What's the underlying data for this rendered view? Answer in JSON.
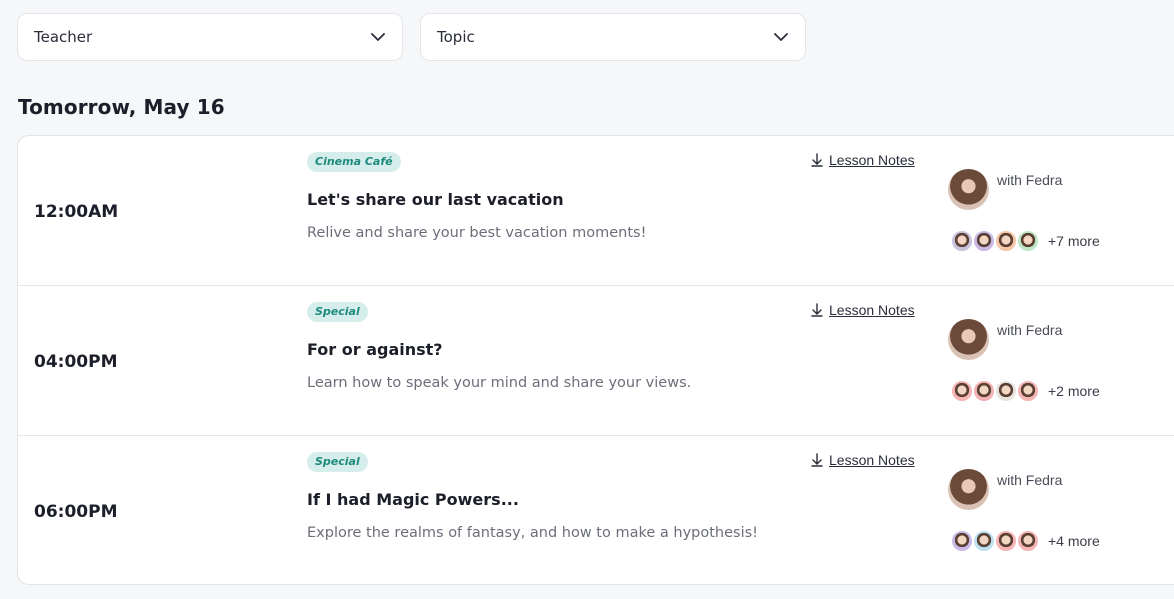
{
  "filters": {
    "teacher_label": "Teacher",
    "topic_label": "Topic"
  },
  "date_heading": "Tomorrow, May 16",
  "lesson_notes_label": "Lesson Notes",
  "lessons": [
    {
      "time": "12:00AM",
      "tag": "Cinema Café",
      "title": "Let's share our last vacation",
      "description": "Relive and share your best vacation moments!",
      "teacher": "with Fedra",
      "more": "+7 more",
      "student_colors": [
        "#c8c2dc",
        "#c9b9e6",
        "#f6c6a8",
        "#bfe6c7"
      ]
    },
    {
      "time": "04:00PM",
      "tag": "Special",
      "title": "For or against?",
      "description": "Learn how to speak your mind and share your views.",
      "teacher": "with Fedra",
      "more": "+2 more",
      "student_colors": [
        "#f5b5b5",
        "#f2b2b2",
        "#e9e3df",
        "#f5b5b5"
      ]
    },
    {
      "time": "06:00PM",
      "tag": "Special",
      "title": "If I had Magic Powers...",
      "description": "Explore the realms of fantasy, and how to make a hypothesis!",
      "teacher": "with Fedra",
      "more": "+4 more",
      "student_colors": [
        "#c9b9e6",
        "#bfe0ef",
        "#f5b5b5",
        "#f5b5b5"
      ]
    }
  ],
  "colors": {
    "tag_bg": "#d6eeeb",
    "tag_text": "#1f8a7e",
    "page_bg": "#f6f7f8"
  },
  "icons": {
    "select_chevron": "chevron-down-icon",
    "lesson_notes": "download-icon"
  }
}
